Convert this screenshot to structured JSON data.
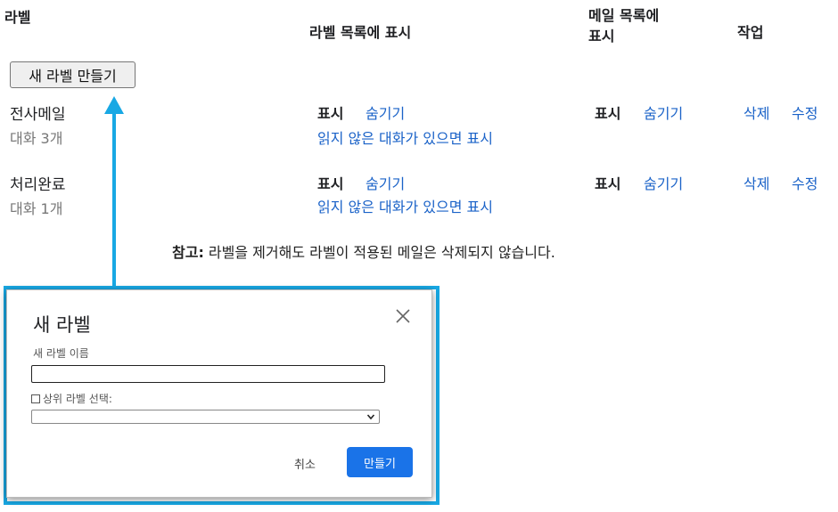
{
  "header": {
    "label": "라벨",
    "show_in_label_list": "라벨 목록에 표시",
    "show_in_mail_list_line1": "메일 목록에",
    "show_in_mail_list_line2": "표시",
    "actions": "작업"
  },
  "create_button": "새 라벨 만들기",
  "labels": [
    {
      "name": "전사메일",
      "count": "대화 3개",
      "list_show": "표시",
      "list_hide": "숨기기",
      "list_unread": "읽지 않은 대화가 있으면 표시",
      "mail_show": "표시",
      "mail_hide": "숨기기",
      "delete": "삭제",
      "edit": "수정"
    },
    {
      "name": "처리완료",
      "count": "대화 1개",
      "list_show": "표시",
      "list_hide": "숨기기",
      "list_unread": "읽지 않은 대화가 있으면 표시",
      "mail_show": "표시",
      "mail_hide": "숨기기",
      "delete": "삭제",
      "edit": "수정"
    }
  ],
  "note": {
    "prefix": "참고:",
    "text": " 라벨을 제거해도 라벨이 적용된 메일은 삭제되지 않습니다."
  },
  "dialog": {
    "title": "새 라벨",
    "name_label": "새 라벨 이름",
    "name_value": "",
    "parent_label": "상위 라벨 선택:",
    "parent_value": "",
    "cancel": "취소",
    "create": "만들기",
    "close_icon": "close-icon"
  },
  "colors": {
    "link": "#1a62c8",
    "highlight": "#18a8e4",
    "primary_button": "#1a73e8"
  }
}
